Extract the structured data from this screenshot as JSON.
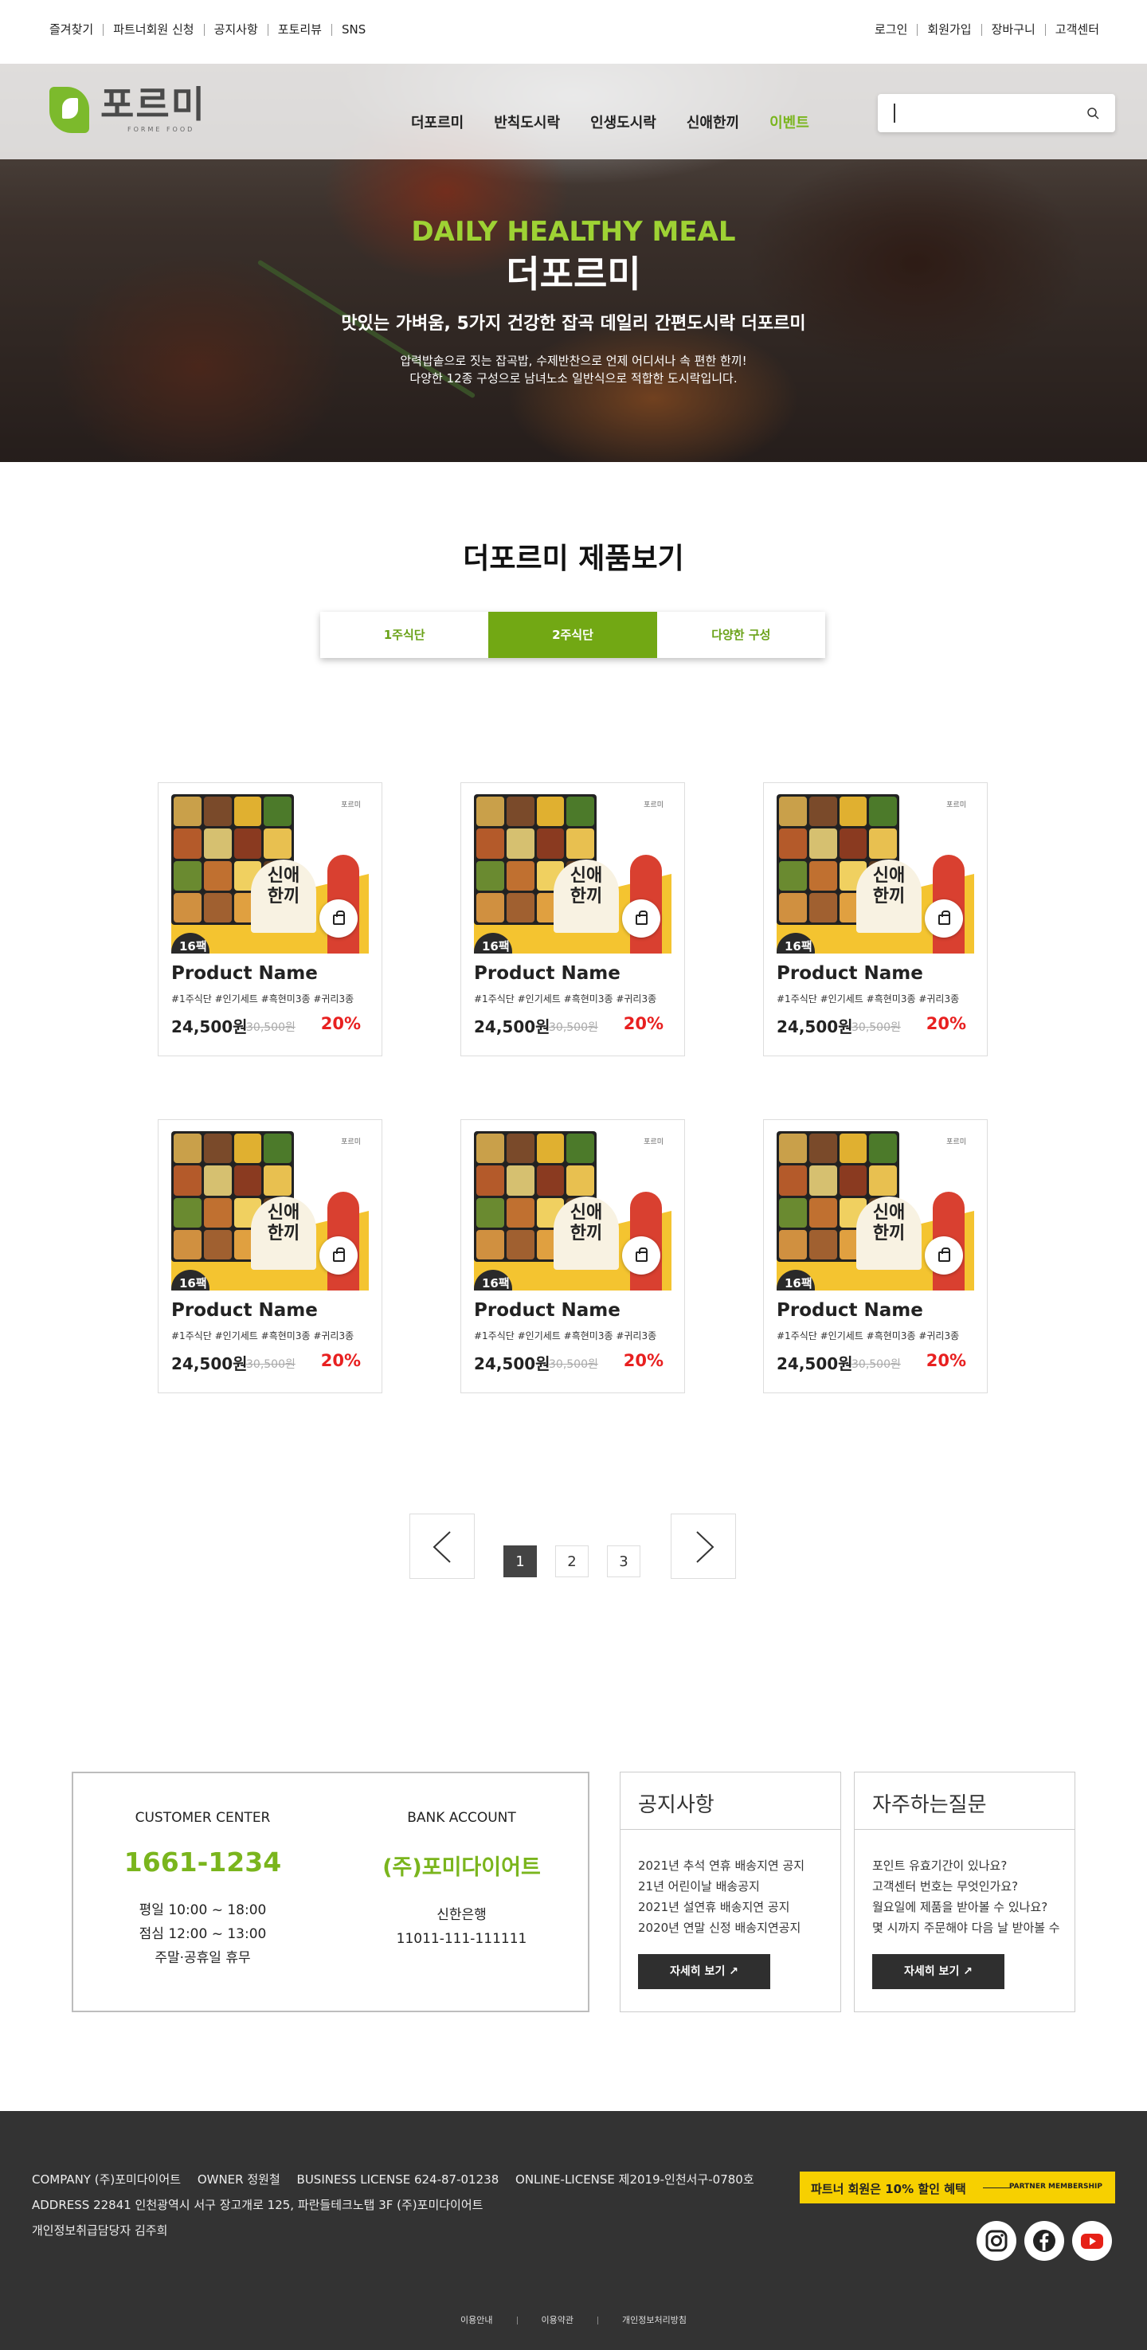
{
  "topbar": {
    "left": [
      "즐겨찾기",
      "파트너회원 신청",
      "공지사항",
      "포토리뷰",
      "SNS"
    ],
    "right": [
      "로그인",
      "회원가입",
      "장바구니",
      "고객센터"
    ]
  },
  "logo": {
    "kor": "포르미",
    "eng": "FORME FOOD"
  },
  "nav": [
    "더포르미",
    "반칙도시락",
    "인생도시락",
    "신애한끼",
    "이벤트"
  ],
  "nav_active_index": 4,
  "search": {
    "placeholder": "",
    "value": ""
  },
  "hero": {
    "en": "DAILY HEALTHY MEAL",
    "ko": "더포르미",
    "sub": "맛있는 가벼움, 5가지 건강한 잡곡 데일리 간편도시락 더포르미",
    "desc1": "압력밥솥으로 짓는 잡곡밥, 수제반찬으로 언제 어디서나 속 편한 한끼!",
    "desc2": "다양한 12종 구성으로 남녀노소 일반식으로 적합한 도시락입니다."
  },
  "section_title": "더포르미 제품보기",
  "tabs": [
    "1주식단",
    "2주식단",
    "다양한 구성"
  ],
  "active_tab": 1,
  "products": [
    {
      "name": "Product Name",
      "tags": "#1주식단 #인기세트 #흑현미3종 #귀리3종",
      "price": "24,500원",
      "original": "30,500원",
      "discount": "20%"
    },
    {
      "name": "Product Name",
      "tags": "#1주식단 #인기세트 #흑현미3종 #귀리3종",
      "price": "24,500원",
      "original": "30,500원",
      "discount": "20%"
    },
    {
      "name": "Product Name",
      "tags": "#1주식단 #인기세트 #흑현미3종 #귀리3종",
      "price": "24,500원",
      "original": "30,500원",
      "discount": "20%"
    },
    {
      "name": "Product Name",
      "tags": "#1주식단 #인기세트 #흑현미3종 #귀리3종",
      "price": "24,500원",
      "original": "30,500원",
      "discount": "20%"
    },
    {
      "name": "Product Name",
      "tags": "#1주식단 #인기세트 #흑현미3종 #귀리3종",
      "price": "24,500원",
      "original": "30,500원",
      "discount": "20%"
    },
    {
      "name": "Product Name",
      "tags": "#1주식단 #인기세트 #흑현미3종 #귀리3종",
      "price": "24,500원",
      "original": "30,500원",
      "discount": "20%"
    }
  ],
  "product_image": {
    "brand": "포르미",
    "title_line1": "신애",
    "title_line2": "한끼",
    "badge": "16팩"
  },
  "pagination": {
    "pages": [
      "1",
      "2",
      "3"
    ],
    "current": "1"
  },
  "customer_center": {
    "title": "CUSTOMER CENTER",
    "phone": "1661-1234",
    "hours": [
      "평일 10:00 ~ 18:00",
      "점심 12:00 ~ 13:00",
      "주말·공휴일 휴무"
    ]
  },
  "bank": {
    "title": "BANK ACCOUNT",
    "holder": "(주)포미다이어트",
    "bank_name": "신한은행",
    "account": "11011-111-111111"
  },
  "notice": {
    "title": "공지사항",
    "items": [
      "2021년 추석 연휴 배송지연 공지",
      "21년 어린이날 배송공지",
      "2021년 설연휴 배송지연 공지",
      "2020년 연말 신정 배송지연공지"
    ],
    "more": "자세히 보기"
  },
  "faq": {
    "title": "자주하는질문",
    "items": [
      "포인트 유효기간이 있나요?",
      "고객센터 번호는 무엇인가요?",
      "월요일에 제품을 받아볼 수 있나요?",
      "몇 시까지 주문해야 다음 날 받아볼 수 있나요?"
    ],
    "more": "자세히 보기"
  },
  "footer": {
    "company": "COMPANY (주)포미다이어트",
    "owner": "OWNER 정원철",
    "license": "BUSINESS LICENSE 624-87-01238",
    "online": "ONLINE-LICENSE 제2019-인천서구-0780호",
    "address": "ADDRESS 22841 인천광역시 서구 장고개로 125, 파란들테크노탭 3F (주)포미다이어트",
    "privacy": "개인정보취급담당자 김주희",
    "links": [
      "이용안내",
      "이용약관",
      "개인정보처리방침"
    ]
  },
  "partner": {
    "text": "파트너 회원은 10% 할인 혜택",
    "sub": "PARTNER MEMBERSHIP"
  },
  "social": [
    "instagram-icon",
    "facebook-icon",
    "youtube-icon"
  ],
  "colors": {
    "accent": "#7ab51d",
    "discount": "#e82020",
    "footer_bg": "#333333",
    "partner": "#f7d000"
  }
}
